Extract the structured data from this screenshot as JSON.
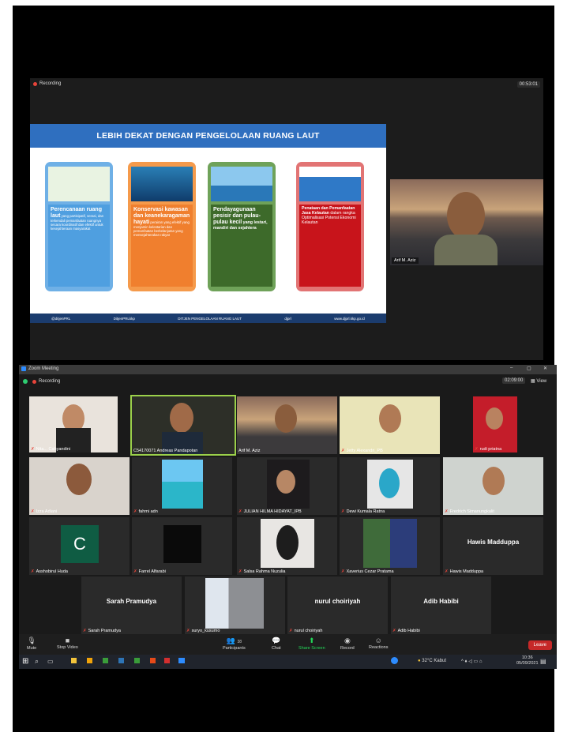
{
  "top_share": {
    "recording": "Recording",
    "timer": "00:53:01",
    "slide": {
      "title": "LEBIH DEKAT DENGAN PENGELOLAAN RUANG LAUT",
      "cards": [
        {
          "bold": "Perencanaan ruang laut",
          "rest": " yang partisipatif, serasi, dan terkendali pemanfaatan ruangnya secara koordinatif dan efektif untuk kesejahteraan masyarakat"
        },
        {
          "bold": "Konservasi kawasan dan keanekaragaman hayati",
          "rest": " perairan yang efektif yang menjamin kelestarian dan pemanfaatan berkelanjutan yang mensejahterakan rakyat"
        },
        {
          "bold": "Pendayagunaan pesisir dan pulau-pulau kecil",
          "rest": " yang lestari, mandiri dan sejahtera"
        },
        {
          "bold": "Penataan dan Pemanfaatan Jasa Kelautan",
          "rest": " dalam rangka Optimalisasi Potensi Ekonomi Kelautan"
        }
      ],
      "footer": [
        "@ditjenPRL",
        "DitjenPRLkkp",
        "DITJEN PENGELOLAAN RUANG LAUT",
        "djprl",
        "www.djprl.kkp.go.id"
      ]
    },
    "speaker_name": "Arif M. Aziz"
  },
  "zoom": {
    "title": "Zoom Meeting",
    "recording": "Recording",
    "timer": "02:09:00",
    "view": "View",
    "participants": [
      "Nita... Cahyandini",
      "C54170071 Andreas Pandapotan",
      "Arif M. Aziz",
      "Jetty Alexandri_PB",
      "rudi priatna",
      "Izza Adiani",
      "fahmi adn",
      "JULIAN HILMA HIDAYAT_IPB",
      "Dewi Kumala Ratna",
      "Fredrich Simanungkalit",
      "Asshobirul Huda",
      "Farrel Alfarabi",
      "Salsa Rahma Nuzulia",
      "Xaverius Cezar Pratama",
      "Hawis Madduppa",
      "Sarah Pramudya",
      "suryo_kusumo",
      "nurul choiriyah",
      "Adib Habibi"
    ],
    "avatar_letter": "C",
    "big_names": {
      "hawis": "Hawis Madduppa",
      "sarah": "Sarah Pramudya",
      "nurul": "nurul choiriyah",
      "adib": "Adib Habibi"
    },
    "toolbar": {
      "mute": "Mute",
      "stop_video": "Stop Video",
      "participants": "Participants",
      "participants_count": "38",
      "chat": "Chat",
      "share_screen": "Share Screen",
      "record": "Record",
      "reactions": "Reactions",
      "leave": "Leave"
    },
    "taskbar": {
      "weather": "32°C Kabut",
      "time": "10:36",
      "date": "05/09/2021"
    }
  },
  "colors": {
    "accent_green": "#23d959",
    "leave_red": "#c62828",
    "slide_blue": "#2f6fbf"
  }
}
